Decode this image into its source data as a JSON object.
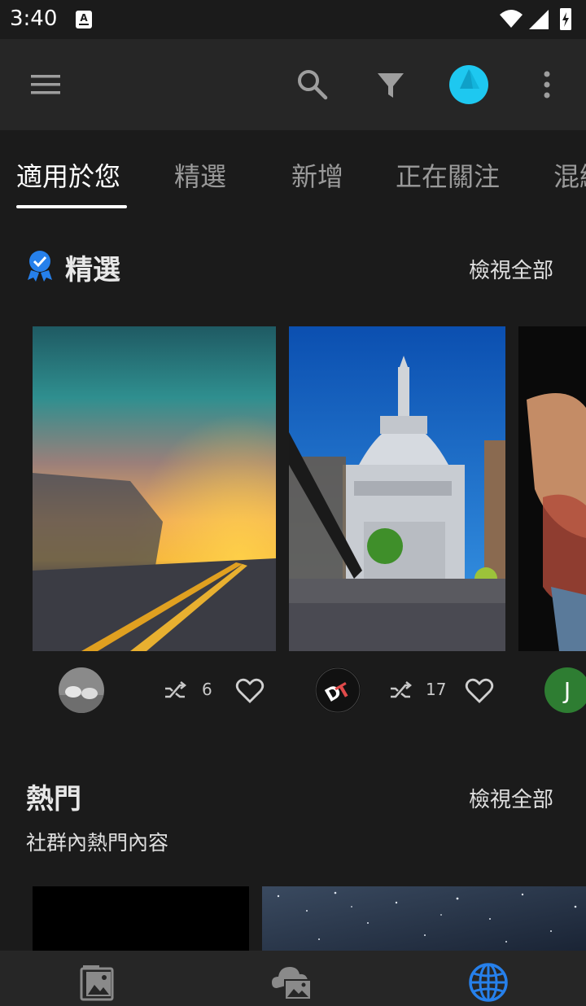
{
  "status_bar": {
    "time": "3:40",
    "notification_icon": "A",
    "icons": [
      "wifi-icon",
      "signal-icon",
      "battery-charging-icon"
    ]
  },
  "app_bar": {
    "icons": [
      "menu-icon",
      "search-icon",
      "filter-icon",
      "profile-avatar",
      "more-vert-icon"
    ],
    "accent_color": "#1ec8f0"
  },
  "tabs": [
    {
      "label": "適用於您",
      "active": true
    },
    {
      "label": "精選",
      "active": false
    },
    {
      "label": "新增",
      "active": false
    },
    {
      "label": "正在關注",
      "active": false
    },
    {
      "label": "混編",
      "active": false
    }
  ],
  "featured": {
    "title": "精選",
    "badge_icon": "award-badge-icon",
    "view_all": "檢視全部",
    "cards": [
      {
        "remix_count": "6",
        "author": "avatar-cows"
      },
      {
        "remix_count": "17",
        "author": "avatar-dt-logo"
      },
      {
        "author_initial": "J",
        "author_color": "#2e7d32"
      }
    ]
  },
  "popular": {
    "title": "熱門",
    "view_all": "檢視全部",
    "subtitle": "社群內熱門內容"
  },
  "bottom_nav": {
    "items": [
      "library-icon",
      "cloud-photos-icon",
      "discover-globe-icon"
    ],
    "active_color": "#2680eb"
  }
}
